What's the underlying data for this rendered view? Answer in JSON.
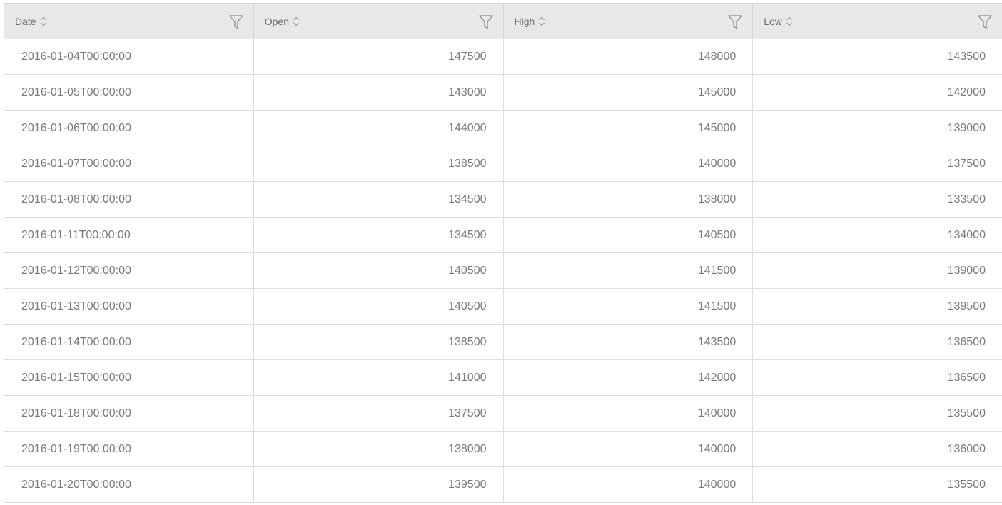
{
  "columns": [
    {
      "label": "Date",
      "sort_icon": "sort-icon",
      "filter_icon": "filter-icon"
    },
    {
      "label": "Open",
      "sort_icon": "sort-icon",
      "filter_icon": "filter-icon"
    },
    {
      "label": "High",
      "sort_icon": "sort-icon",
      "filter_icon": "filter-icon"
    },
    {
      "label": "Low",
      "sort_icon": "sort-icon",
      "filter_icon": "filter-icon"
    }
  ],
  "rows": [
    {
      "date": "2016-01-04T00:00:00",
      "open": "147500",
      "high": "148000",
      "low": "143500"
    },
    {
      "date": "2016-01-05T00:00:00",
      "open": "143000",
      "high": "145000",
      "low": "142000"
    },
    {
      "date": "2016-01-06T00:00:00",
      "open": "144000",
      "high": "145000",
      "low": "139000"
    },
    {
      "date": "2016-01-07T00:00:00",
      "open": "138500",
      "high": "140000",
      "low": "137500"
    },
    {
      "date": "2016-01-08T00:00:00",
      "open": "134500",
      "high": "138000",
      "low": "133500"
    },
    {
      "date": "2016-01-11T00:00:00",
      "open": "134500",
      "high": "140500",
      "low": "134000"
    },
    {
      "date": "2016-01-12T00:00:00",
      "open": "140500",
      "high": "141500",
      "low": "139000"
    },
    {
      "date": "2016-01-13T00:00:00",
      "open": "140500",
      "high": "141500",
      "low": "139500"
    },
    {
      "date": "2016-01-14T00:00:00",
      "open": "138500",
      "high": "143500",
      "low": "136500"
    },
    {
      "date": "2016-01-15T00:00:00",
      "open": "141000",
      "high": "142000",
      "low": "136500"
    },
    {
      "date": "2016-01-18T00:00:00",
      "open": "137500",
      "high": "140000",
      "low": "135500"
    },
    {
      "date": "2016-01-19T00:00:00",
      "open": "138000",
      "high": "140000",
      "low": "136000"
    },
    {
      "date": "2016-01-20T00:00:00",
      "open": "139500",
      "high": "140000",
      "low": "135500"
    }
  ]
}
